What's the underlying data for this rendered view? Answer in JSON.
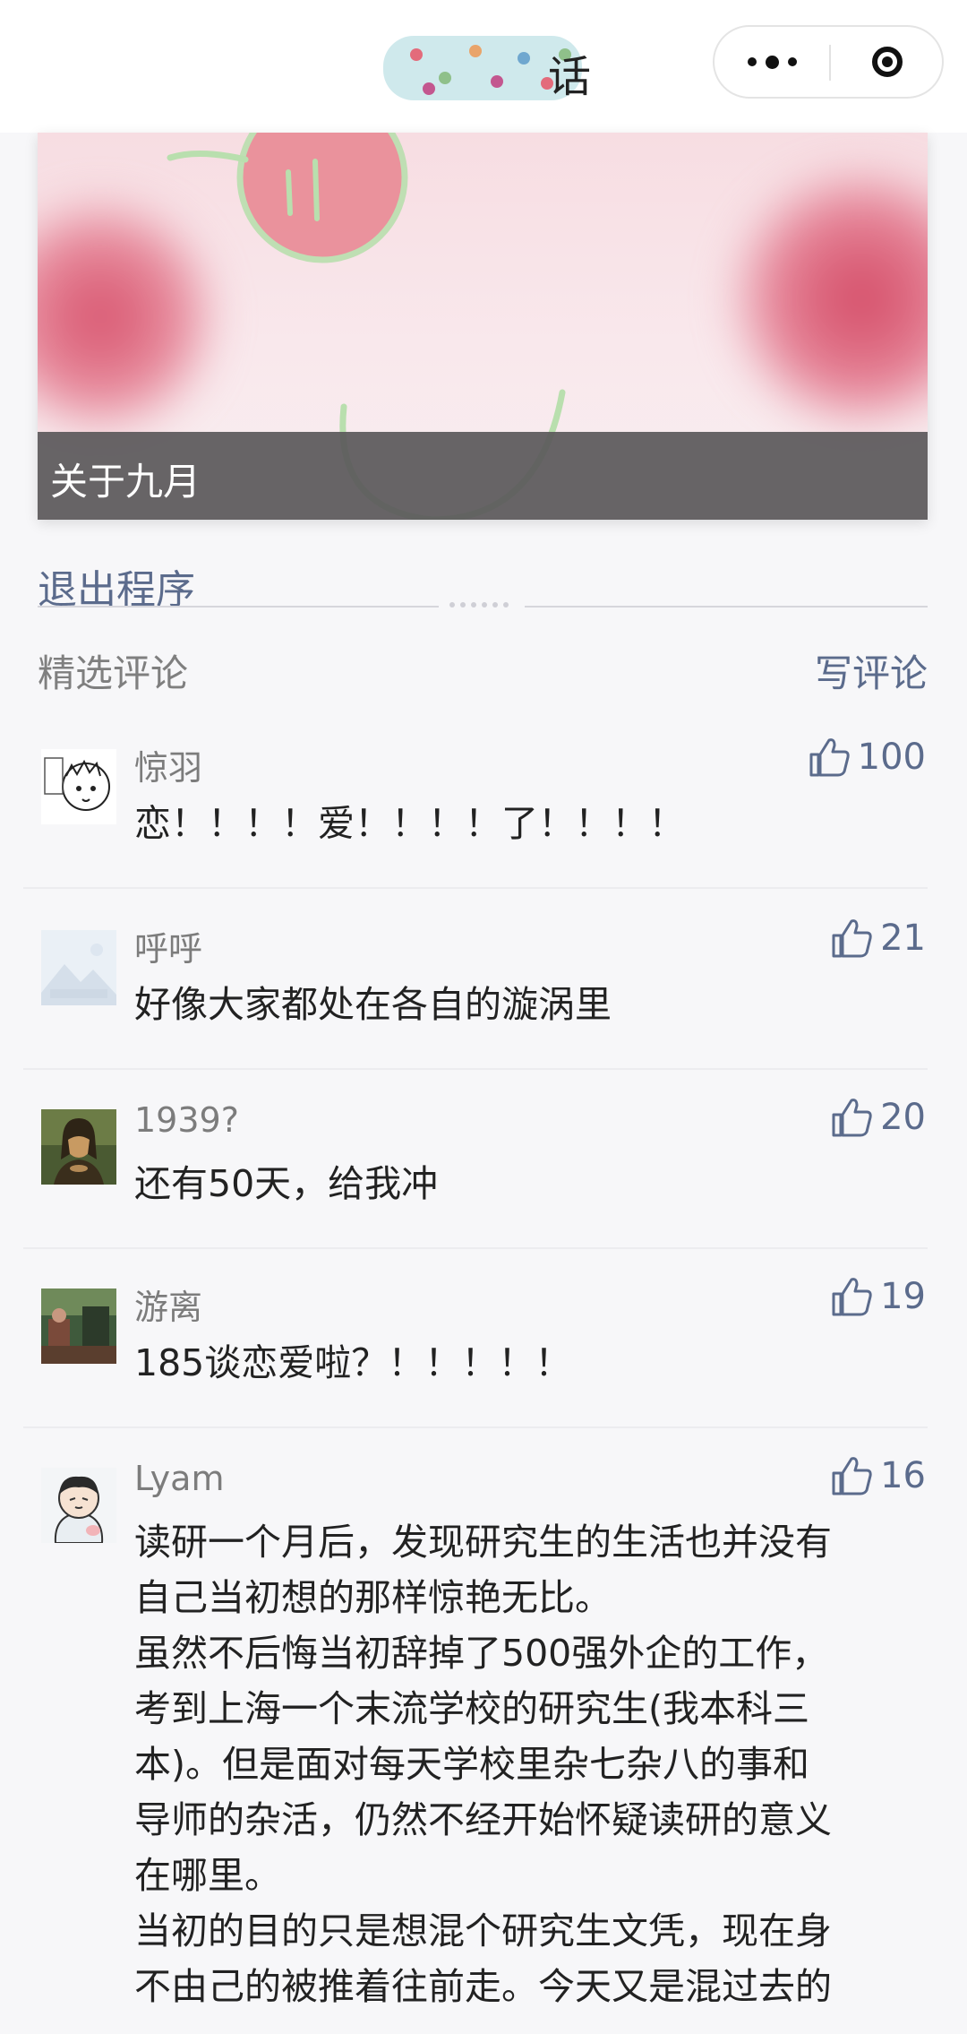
{
  "nav": {
    "title_fragment": "话",
    "more_icon": "more-dots-icon",
    "close_icon": "target-circle-icon"
  },
  "hero": {
    "caption": "关于九月",
    "accent_color": "#d8556f"
  },
  "exit_link": "退出程序",
  "comments_section": {
    "title": "精选评论",
    "write_label": "写评论",
    "link_color": "#5b6b8c",
    "items": [
      {
        "nick": "惊羽",
        "likes": "100",
        "text": "恋！！！！爱！！！！了！！！！"
      },
      {
        "nick": "呼呼",
        "likes": "21",
        "text": "好像大家都处在各自的漩涡里"
      },
      {
        "nick": "1939?",
        "likes": "20",
        "text": "还有50天，给我冲"
      },
      {
        "nick": "游离",
        "likes": "19",
        "text": "185谈恋爱啦？！！！！！"
      },
      {
        "nick": "Lyam",
        "likes": "16",
        "text": "读研一个月后，发现研究生的生活也并没有\n自己当初想的那样惊艳无比。\n虽然不后悔当初辞掉了500强外企的工作，\n考到上海一个末流学校的研究生(我本科三\n本)。但是面对每天学校里杂七杂八的事和\n导师的杂活，仍然不经开始怀疑读研的意义\n在哪里。\n当初的目的只是想混个研究生文凭，现在身\n不由己的被推着往前走。今天又是混过去的"
      }
    ]
  }
}
